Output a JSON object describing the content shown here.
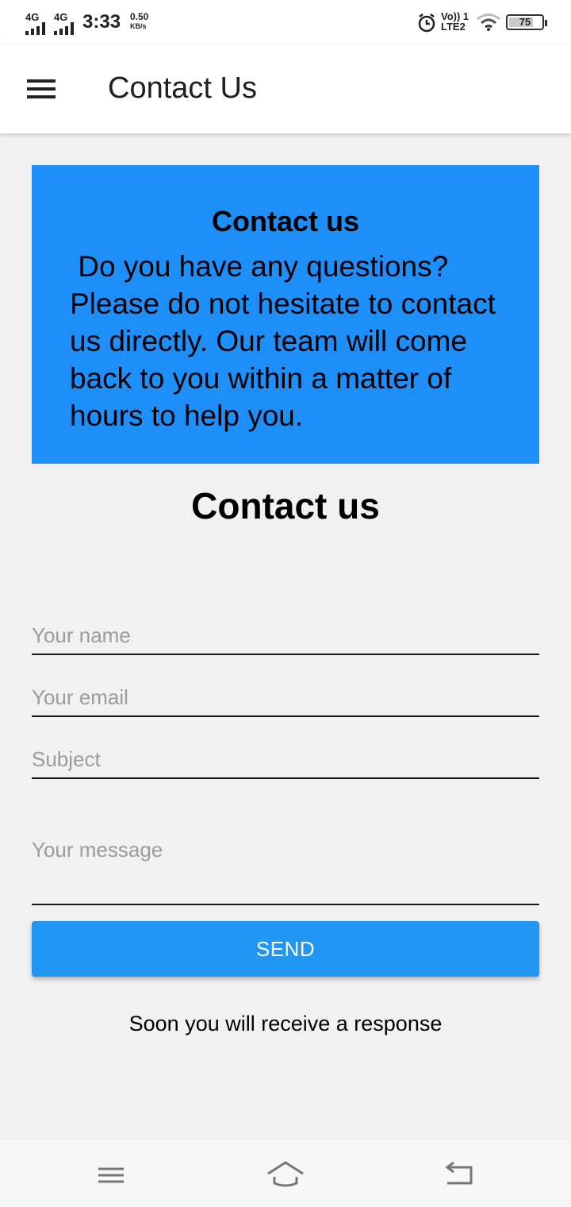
{
  "status_bar": {
    "sim1": "4G",
    "sim2": "4G",
    "time": "3:33",
    "speed_value": "0.50",
    "speed_unit": "KB/s",
    "volte_line1": "Vo)) 1",
    "volte_line2": "LTE2",
    "battery": "75",
    "battery_level": 0.75
  },
  "app_bar": {
    "title": "Contact Us"
  },
  "info_card": {
    "title": "Contact us",
    "body": " Do you have any questions? Please do not hesitate to contact us directly. Our team will come back to you within a matter of hours to help you.",
    "color": "#1e8ef9"
  },
  "form": {
    "heading": "Contact us",
    "name_placeholder": "Your name",
    "email_placeholder": "Your email",
    "subject_placeholder": "Subject",
    "message_placeholder": "Your message",
    "send_label": "SEND",
    "note": "Soon you will receive a response"
  },
  "colors": {
    "accent": "#2196f3",
    "background": "#f1f1f1"
  }
}
